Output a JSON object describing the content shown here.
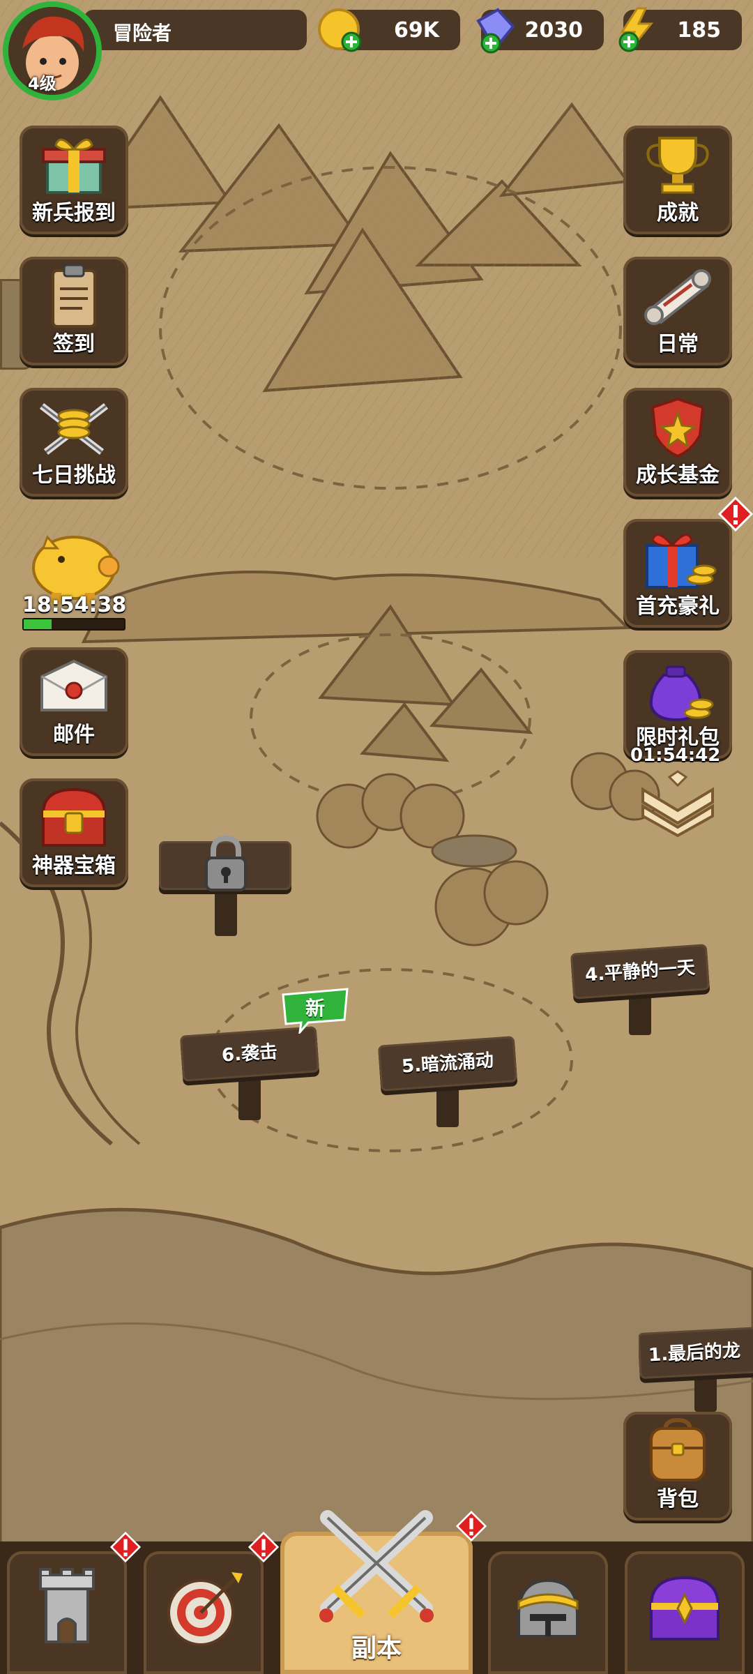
{
  "player": {
    "name": "冒险者",
    "level": "4级"
  },
  "resources": {
    "gold": "69K",
    "gems": "2030",
    "energy": "185"
  },
  "left_menu": [
    {
      "label": "新兵报到",
      "icon": "gift-box-icon"
    },
    {
      "label": "签到",
      "icon": "clipboard-icon"
    },
    {
      "label": "七日挑战",
      "icon": "crossed-swords-coins-icon"
    },
    {
      "label": "",
      "icon": "piggy-bank-icon",
      "timer": "18:54:38",
      "progress": 0.28
    },
    {
      "label": "邮件",
      "icon": "letter-icon"
    },
    {
      "label": "神器宝箱",
      "icon": "treasure-chest-icon"
    }
  ],
  "right_menu": [
    {
      "label": "成就",
      "icon": "trophy-icon"
    },
    {
      "label": "日常",
      "icon": "scroll-icon"
    },
    {
      "label": "成长基金",
      "icon": "shield-badge-icon"
    },
    {
      "label": "首充豪礼",
      "icon": "gift-box-icon",
      "alert": true
    },
    {
      "label": "限时礼包",
      "icon": "coin-bag-icon",
      "timer": "01:54:42"
    }
  ],
  "map_signs": [
    {
      "label": "4.平静的一天"
    },
    {
      "label": "5.暗流涌动"
    },
    {
      "label": "6.袭击",
      "badge": "新"
    },
    {
      "label": "1.最后的龙"
    }
  ],
  "bag": {
    "label": "背包"
  },
  "bottom_nav": {
    "active_label": "副本"
  }
}
